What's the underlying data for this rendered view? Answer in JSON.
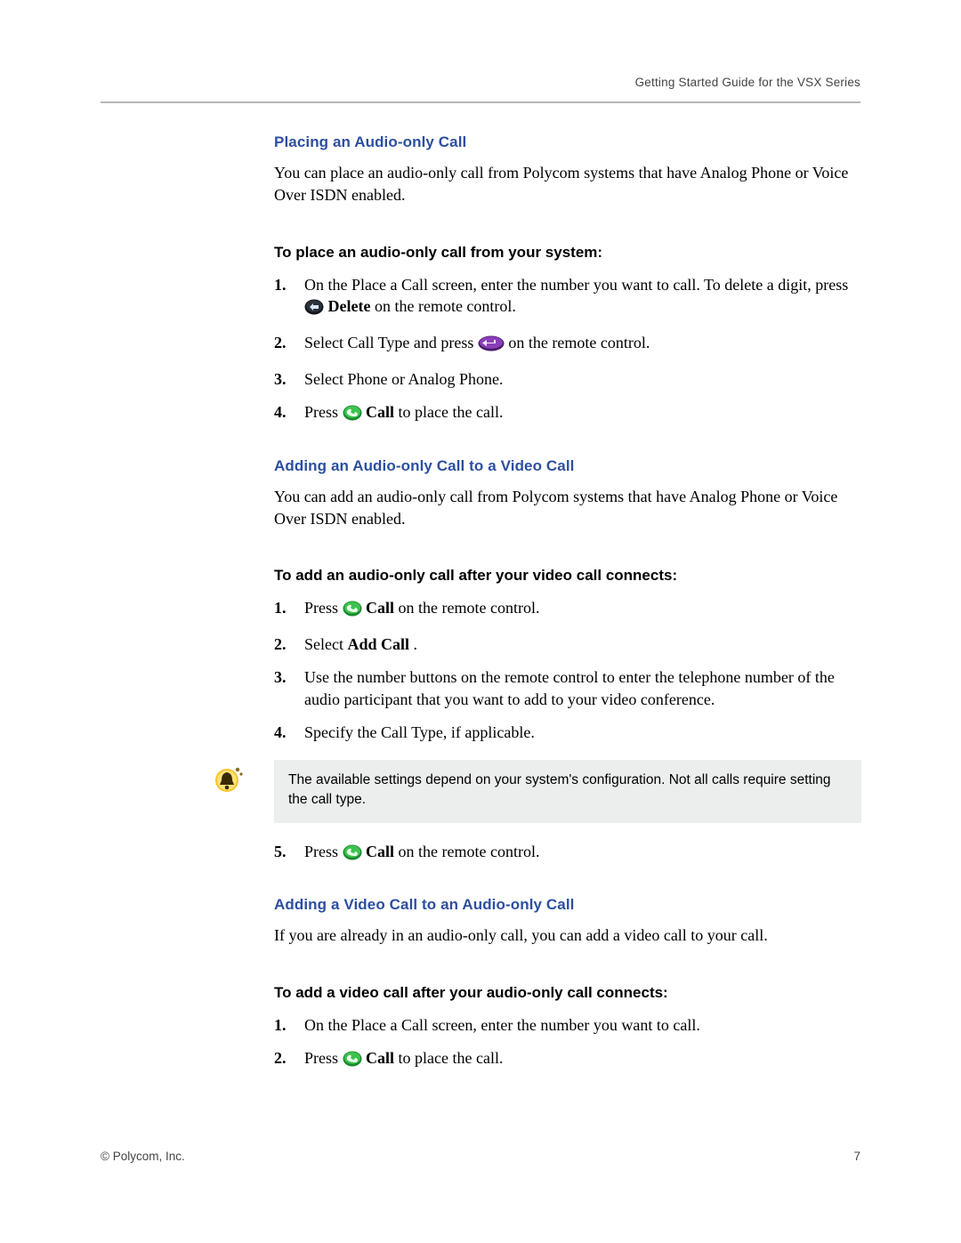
{
  "header": {
    "running": "Getting Started Guide for the VSX Series"
  },
  "s1": {
    "title": "Placing an Audio-only Call",
    "intro": "You can place an audio-only call from Polycom systems that have Analog Phone or Voice Over ISDN enabled.",
    "proc_title": "To place an audio-only call from your system:",
    "step1_a": "On the Place a Call screen, enter the number you want to call. To delete a digit, press ",
    "step1_b": " Delete",
    "step1_c": " on the remote control.",
    "step2_a": "Select Call Type and press ",
    "step2_b": " on the remote control.",
    "step3": "Select Phone or Analog Phone.",
    "step4_a": "Press ",
    "step4_b": " Call",
    "step4_c": " to place the call."
  },
  "s2": {
    "title": "Adding an Audio-only Call to a Video Call",
    "intro": "You can add an audio-only call from Polycom systems that have Analog Phone or Voice Over ISDN enabled.",
    "proc_title": "To add an audio-only call after your video call connects:",
    "step1_a": "Press ",
    "step1_b": " Call",
    "step1_c": " on the remote control.",
    "step2_a": "Select ",
    "step2_b": "Add Call",
    "step2_c": ".",
    "step3": "Use the number buttons on the remote control to enter the telephone number of the audio participant that you want to add to your video conference.",
    "step4": "Specify the Call Type, if applicable.",
    "note": "The available settings depend on your system's configuration. Not all calls require setting the call type.",
    "step5_a": "Press ",
    "step5_b": " Call",
    "step5_c": " on the remote control."
  },
  "s3": {
    "title": "Adding a Video Call to an Audio-only Call",
    "intro": "If you are already in an audio-only call, you can add a video call to your call.",
    "proc_title": "To add a video call after your audio-only call connects:",
    "step1": "On the Place a Call screen, enter the number you want to call.",
    "step2_a": "Press ",
    "step2_b": " Call",
    "step2_c": " to place the call."
  },
  "footer": {
    "left": "© Polycom, Inc.",
    "right": "7"
  }
}
